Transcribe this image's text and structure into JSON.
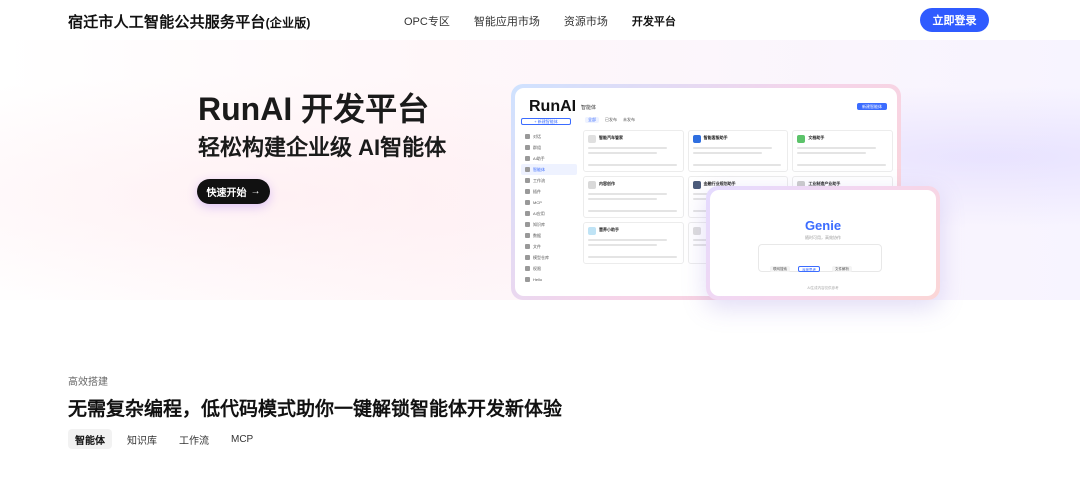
{
  "header": {
    "brand": "宿迁市人工智能公共服务平台",
    "brand_suffix": "(企业版)",
    "nav": [
      {
        "label": "OPC专区"
      },
      {
        "label": "智能应用市场"
      },
      {
        "label": "资源市场"
      },
      {
        "label": "开发平台"
      }
    ],
    "active_nav": "开发平台",
    "login_label": "立即登录"
  },
  "hero": {
    "title": "RunAI 开发平台",
    "subtitle": "轻松构建企业级 AI智能体",
    "cta_label": "快速开始",
    "cta_icon": "arrow-right-icon"
  },
  "mock_app": {
    "logo": "RunAI",
    "top_menu": "智能体",
    "create_label": "新建智能体",
    "new_button": "+ 新建智能体",
    "sidebar_items": [
      "对话",
      "群组",
      "",
      "AI助手",
      "智能体",
      "工作流",
      "插件",
      "MCP",
      "AI应用",
      "知识库",
      "数据",
      "文件",
      "模型仓库",
      "权限",
      "Hello"
    ],
    "tabs": [
      "全部",
      "已发布",
      "未发布"
    ],
    "cards": [
      {
        "name": "智能汽车管家",
        "color": "#e0e0e0"
      },
      {
        "name": "智能客服助手",
        "color": "#2f6fe0"
      },
      {
        "name": "文档助手",
        "color": "#5cc36a"
      },
      {
        "name": "内容创作",
        "color": "#d9d9d9"
      },
      {
        "name": "金融行业规划助手",
        "color": "#4b5b7a"
      },
      {
        "name": "工业制造产业助手",
        "color": "#cccccc"
      },
      {
        "name": "营养小助手",
        "color": "#bfe3f5"
      },
      {
        "name": "",
        "color": "#dddddd"
      }
    ]
  },
  "genie": {
    "title": "Genie",
    "subtitle": "随时可用，高效协作",
    "chips": [
      "联网搜索",
      "深度思考",
      "文件解析"
    ],
    "footer": "AI生成内容仅供参考"
  },
  "section": {
    "eyebrow": "高效搭建",
    "title": "无需复杂编程，低代码模式助你一键解锁智能体开发新体验",
    "tabs": [
      {
        "label": "智能体"
      },
      {
        "label": "知识库"
      },
      {
        "label": "工作流"
      },
      {
        "label": "MCP"
      }
    ],
    "active_tab": "智能体"
  },
  "colors": {
    "accent": "#2f5bff",
    "cta_bg": "#111111"
  }
}
